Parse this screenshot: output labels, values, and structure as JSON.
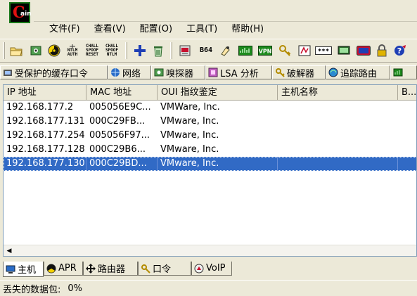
{
  "menu": [
    "文件(F)",
    "查看(V)",
    "配置(O)",
    "工具(T)",
    "帮助(H)"
  ],
  "toolbar": {
    "nltm_auth": [
      "NTLM",
      "AUTH"
    ],
    "chall_spoof_reset": [
      "CHALL",
      "SPOOF",
      "RESET"
    ],
    "chall_spoof_ntlm": [
      "CHALL",
      "SPOOF",
      "NTLM"
    ],
    "b64": "B64",
    "vpn": "VPN",
    "stars": "***"
  },
  "top_tabs": [
    {
      "label": "受保护的缓存口令",
      "icon": "protected-cache-icon"
    },
    {
      "label": "网络",
      "icon": "network-icon"
    },
    {
      "label": "嗅探器",
      "icon": "sniffer-icon"
    },
    {
      "label": "LSA 分析",
      "icon": "lsa-secrets-icon"
    },
    {
      "label": "破解器",
      "icon": "cracker-icon"
    },
    {
      "label": "追踪路由",
      "icon": "traceroute-icon"
    }
  ],
  "table": {
    "columns": [
      "IP 地址",
      "MAC 地址",
      "OUI 指纹鉴定",
      "主机名称",
      "B..."
    ],
    "rows": [
      [
        "192.168.177.2",
        "005056E9C...",
        "VMWare, Inc.",
        "",
        ""
      ],
      [
        "192.168.177.131",
        "000C29FB...",
        "VMware, Inc.",
        "",
        ""
      ],
      [
        "192.168.177.254",
        "005056F97...",
        "VMware, Inc.",
        "",
        ""
      ],
      [
        "192.168.177.128",
        "000C29B6...",
        "VMware, Inc.",
        "",
        ""
      ],
      [
        "192.168.177.130",
        "000C29BD...",
        "VMware, Inc.",
        "",
        ""
      ]
    ],
    "selected_row": 4
  },
  "bottom_tabs": [
    {
      "label": "主机",
      "icon": "hosts-icon",
      "active": true
    },
    {
      "label": "APR",
      "icon": "apr-icon",
      "active": false
    },
    {
      "label": "路由器",
      "icon": "router-icon",
      "active": false
    },
    {
      "label": "口令",
      "icon": "passwords-icon",
      "active": false
    },
    {
      "label": "VoIP",
      "icon": "voip-icon",
      "active": false
    }
  ],
  "status": {
    "label": "丢失的数据包:",
    "value": "0%"
  },
  "colors": {
    "selection": "#316ac5",
    "window_bg": "#ece9d8"
  }
}
